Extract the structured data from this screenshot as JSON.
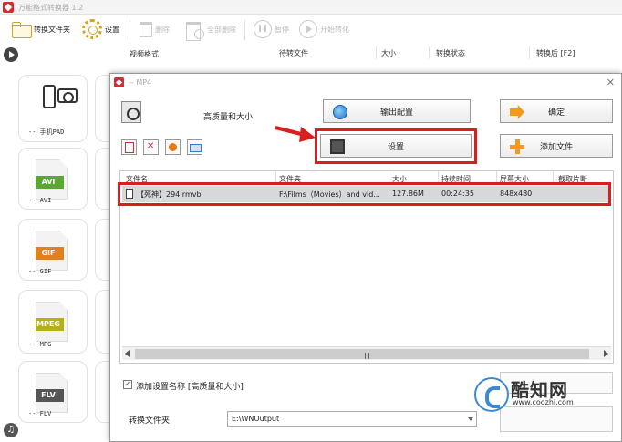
{
  "app": {
    "title": "万能格式转换器 1.2"
  },
  "toolbar": {
    "convert_folder": "转换文件夹",
    "settings": "设置",
    "delete": "删除",
    "delete_all": "全部删除",
    "pause": "暂停",
    "start": "开始转化"
  },
  "main": {
    "video_format_heading": "视频格式",
    "columns": [
      "待转文件",
      "大小",
      "转换状态",
      "转换后 [F2]"
    ]
  },
  "sidebar": {
    "formats": [
      {
        "label": "-- 手机PAD",
        "icon": "phone-camera-icon"
      },
      {
        "label": "-- AVI",
        "badge": "AVI",
        "color": "#5aa832"
      },
      {
        "label": "-- GIF",
        "badge": "GIF",
        "color": "#e0801e"
      },
      {
        "label": "-- MPG",
        "badge": "MPEG",
        "color": "#b6b018"
      },
      {
        "label": "-- FLV",
        "badge": "FLV",
        "color": "#555555"
      }
    ]
  },
  "dialog": {
    "title": "-- MP4",
    "preset_name": "高质量和大小",
    "output_config": "输出配置",
    "ok": "确定",
    "settings": "设置",
    "add_file": "添加文件",
    "columns": [
      "文件名",
      "文件夹",
      "大小",
      "持续时间",
      "屏幕大小",
      "截取片断"
    ],
    "files": [
      {
        "name": "【死神】294.rmvb",
        "folder": "F:\\Films（Movies）and vid...",
        "size": "127.86M",
        "duration": "00:24:35",
        "screen": "848x480"
      }
    ],
    "add_setting_name": "添加设置名称 [高质量和大小]",
    "add_setting_checked": true,
    "output_folder_label": "转换文件夹",
    "output_folder": "E:\\WNOutput"
  },
  "annotations": {
    "color": "#d91e1e"
  },
  "watermark": {
    "name": "酷知网",
    "url": "www.coozhi.com"
  }
}
